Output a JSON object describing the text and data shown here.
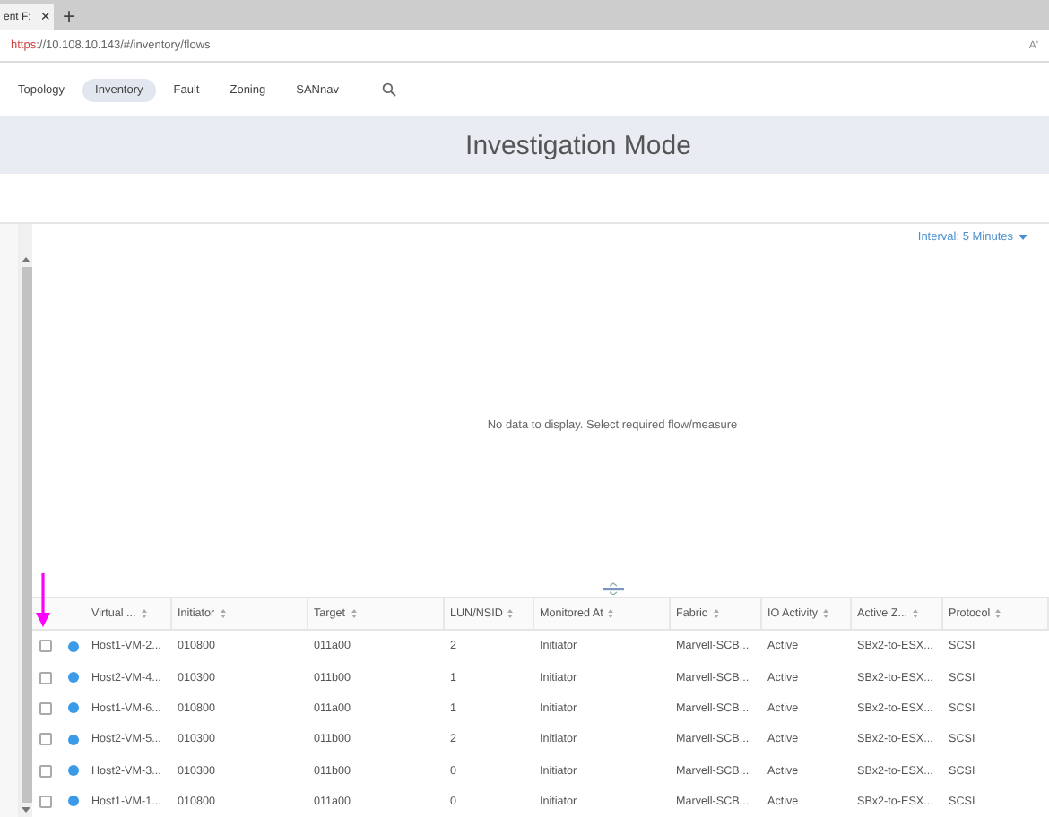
{
  "browser": {
    "tab_title": "ent F:",
    "tab_close": "×",
    "new_tab": "+",
    "url_scheme": "https",
    "url_rest": "://10.108.10.143/#/inventory/flows",
    "reader": "Aʹ"
  },
  "nav": {
    "tabs": [
      {
        "label": "Topology",
        "selected": false
      },
      {
        "label": "Inventory",
        "selected": true
      },
      {
        "label": "Fault",
        "selected": false
      },
      {
        "label": "Zoning",
        "selected": false
      },
      {
        "label": "SANnav",
        "selected": false
      }
    ]
  },
  "banner": {
    "title": "Investigation Mode"
  },
  "interval": {
    "label": "Interval: 5 Minutes"
  },
  "chart": {
    "empty_message": "No data to display. Select required flow/measure"
  },
  "table": {
    "columns": [
      "Virtual ...",
      "Initiator",
      "Target",
      "LUN/NSID",
      "Monitored At",
      "Fabric",
      "IO Activity",
      "Active Z...",
      "Protocol"
    ],
    "rows": [
      {
        "checked": false,
        "color": "#3b9be8",
        "cells": [
          "Host1-VM-2...",
          "010800",
          "011a00",
          "2",
          "Initiator",
          "Marvell-SCB...",
          "Active",
          "SBx2-to-ESX...",
          "SCSI"
        ]
      },
      {
        "checked": false,
        "color": "#3b9be8",
        "cells": [
          "Host2-VM-4...",
          "010300",
          "011b00",
          "1",
          "Initiator",
          "Marvell-SCB...",
          "Active",
          "SBx2-to-ESX...",
          "SCSI"
        ]
      },
      {
        "checked": false,
        "color": "#3b9be8",
        "cells": [
          "Host1-VM-6...",
          "010800",
          "011a00",
          "1",
          "Initiator",
          "Marvell-SCB...",
          "Active",
          "SBx2-to-ESX...",
          "SCSI"
        ]
      },
      {
        "checked": false,
        "color": "#3b9be8",
        "cells": [
          "Host2-VM-5...",
          "010300",
          "011b00",
          "2",
          "Initiator",
          "Marvell-SCB...",
          "Active",
          "SBx2-to-ESX...",
          "SCSI"
        ]
      },
      {
        "checked": false,
        "color": "#3b9be8",
        "cells": [
          "Host2-VM-3...",
          "010300",
          "011b00",
          "0",
          "Initiator",
          "Marvell-SCB...",
          "Active",
          "SBx2-to-ESX...",
          "SCSI"
        ]
      },
      {
        "checked": false,
        "color": "#3b9be8",
        "cells": [
          "Host1-VM-1...",
          "010800",
          "011a00",
          "0",
          "Initiator",
          "Marvell-SCB...",
          "Active",
          "SBx2-to-ESX...",
          "SCSI"
        ]
      }
    ]
  }
}
